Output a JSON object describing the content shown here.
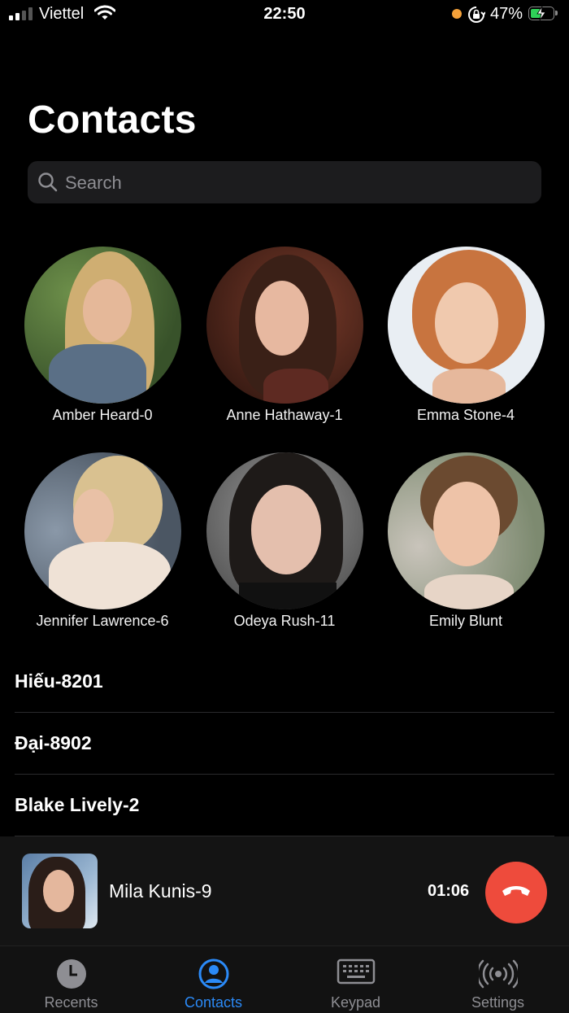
{
  "status_bar": {
    "carrier": "Viettel",
    "time": "22:50",
    "battery_percent": "47%",
    "battery_level": 0.47,
    "charging": true,
    "signal_bars": 2
  },
  "page": {
    "title": "Contacts"
  },
  "search": {
    "placeholder": "Search"
  },
  "favorites": [
    {
      "name": "Amber Heard-0"
    },
    {
      "name": "Anne Hathaway-1"
    },
    {
      "name": "Emma Stone-4"
    },
    {
      "name": "Jennifer Lawrence-6"
    },
    {
      "name": "Odeya Rush-11"
    },
    {
      "name": "Emily Blunt"
    }
  ],
  "contacts": [
    {
      "name": "Hiếu-8201"
    },
    {
      "name": "Đại-8902"
    },
    {
      "name": "Blake Lively-2"
    }
  ],
  "active_call": {
    "name": "Mila Kunis-9",
    "duration": "01:06",
    "end_button_color": "#ee4b3c"
  },
  "tab_bar": {
    "accent": "#2b8af7",
    "items": [
      {
        "label": "Recents",
        "icon": "clock-icon",
        "active": false
      },
      {
        "label": "Contacts",
        "icon": "person-circle-icon",
        "active": true
      },
      {
        "label": "Keypad",
        "icon": "keyboard-icon",
        "active": false
      },
      {
        "label": "Settings",
        "icon": "broadcast-icon",
        "active": false
      }
    ]
  }
}
